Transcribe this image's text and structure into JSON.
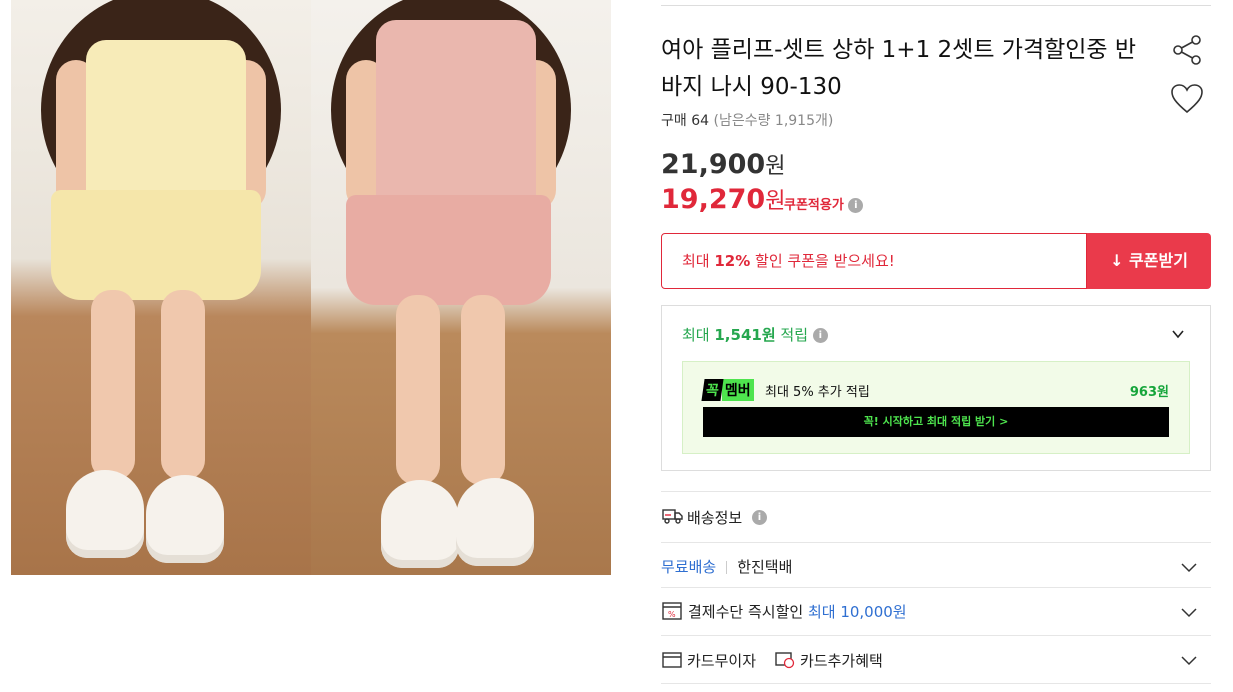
{
  "product": {
    "title": "여아 플리프-셋트 상하 1+1 2셋트 가격할인중 반바지 나시 90-130",
    "purchase_label": "구매 64",
    "remaining": "(남은수량 1,915개)",
    "original_price": "21,900",
    "sale_price": "19,270",
    "price_unit": "원",
    "coupon_applied_label": "쿠폰적용가"
  },
  "coupon": {
    "prefix": "최대 ",
    "percent": "12%",
    "suffix": " 할인 쿠폰을 받으세요!",
    "button_label": "↓ 쿠폰받기"
  },
  "points": {
    "prefix": "최대 ",
    "amount": "1,541원",
    "suffix": " 적립",
    "member_badge_k": "꼭",
    "member_badge_m": "멤버",
    "member_text": "최대 5% 추가 적립",
    "member_amount": "963원",
    "member_button": "꼭! 시작하고 최대 적립 받기 >"
  },
  "shipping": {
    "label": "배송정보",
    "free": "무료배송",
    "carrier": "한진택배",
    "payment_label": "결제수단 즉시할인",
    "payment_max": "최대 10,000원",
    "card_installment": "카드무이자",
    "card_benefit": "카드추가혜택"
  },
  "colors": {
    "accent_red": "#e0283a",
    "green": "#26a74f",
    "blue": "#2f6fd1"
  }
}
